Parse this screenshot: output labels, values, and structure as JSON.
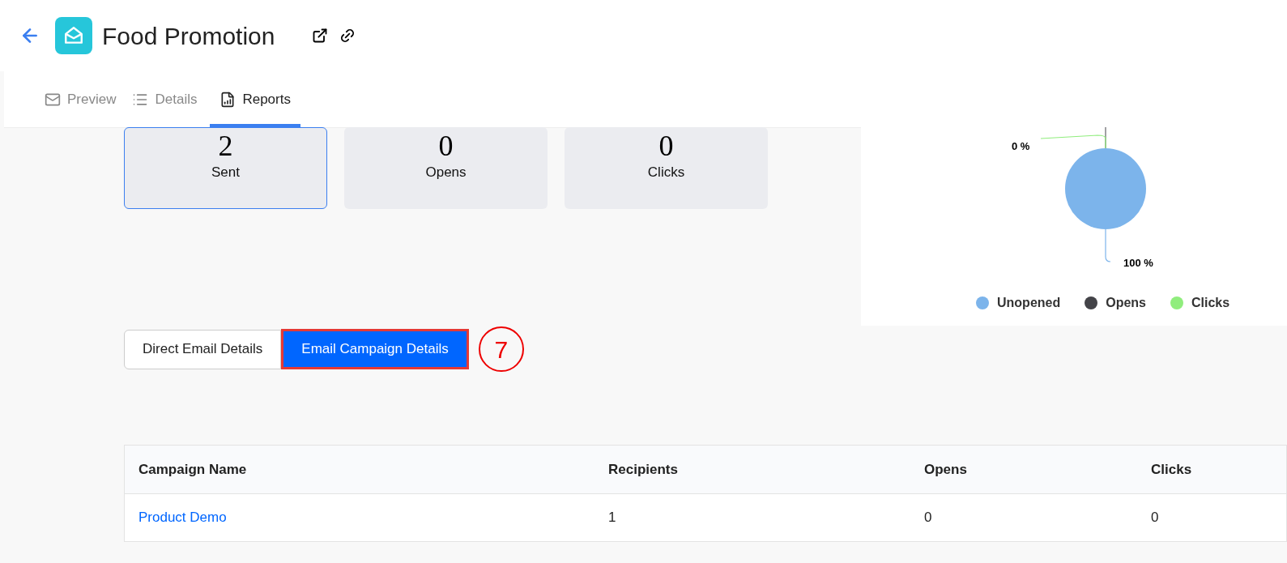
{
  "header": {
    "title": "Food Promotion"
  },
  "tabs": [
    {
      "label": "Preview",
      "kind": "preview",
      "selected": false
    },
    {
      "label": "Details",
      "kind": "details",
      "selected": false
    },
    {
      "label": "Reports",
      "kind": "reports",
      "selected": true
    }
  ],
  "stats": [
    {
      "value": "2",
      "label": "Sent",
      "selected": true
    },
    {
      "value": "0",
      "label": "Opens",
      "selected": false
    },
    {
      "value": "0",
      "label": "Clicks",
      "selected": false
    }
  ],
  "chart": {
    "chart_data": {
      "type": "pie",
      "categories": [
        "Unopened",
        "Opens",
        "Clicks"
      ],
      "values": [
        100,
        0,
        0
      ],
      "value_labels": [
        "100 %",
        null,
        "0 %"
      ]
    },
    "legend": [
      {
        "color": "#7cb4eb"
      },
      {
        "color": "#434348"
      },
      {
        "color": "#90ed7d"
      }
    ]
  },
  "toggles": [
    {
      "label": "Direct Email Details",
      "selected": false
    },
    {
      "label": "Email Campaign Details",
      "selected": true
    }
  ],
  "annotation": {
    "label": "7"
  },
  "table": {
    "columns": [
      "Campaign Name",
      "Recipients",
      "Opens",
      "Clicks"
    ],
    "rows": [
      {
        "cells": [
          "Product Demo",
          "1",
          "0",
          "0"
        ]
      }
    ]
  }
}
